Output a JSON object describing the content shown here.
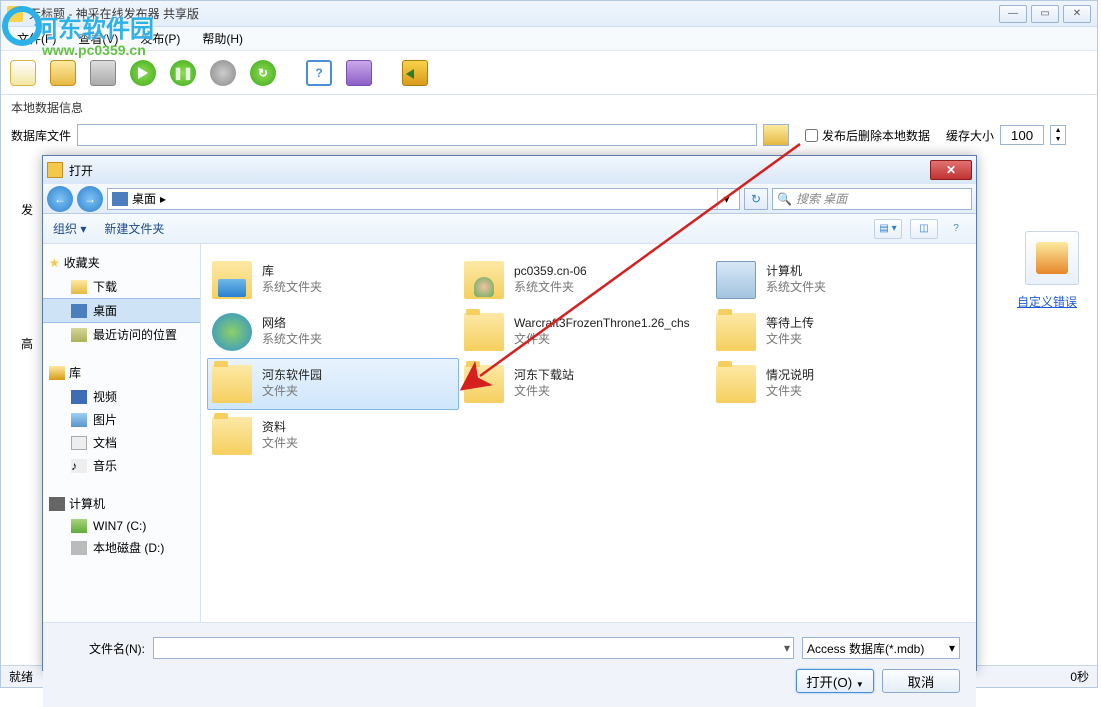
{
  "main": {
    "title": "无标题 - 神采在线发布器 共享版",
    "menu": {
      "file": "文件(F)",
      "view": "查看(V)",
      "publish": "发布(P)",
      "help": "帮助(H)"
    },
    "section_label": "本地数据信息",
    "db_label": "数据库文件",
    "chk_delete": "发布后删除本地数据",
    "cache_label": "缓存大小",
    "cache_value": "100",
    "col_tag": "发",
    "row_tag": "高",
    "custom_err": "自定义错误",
    "status_left": "就绪",
    "status_right": "0秒"
  },
  "watermark": {
    "text": "河东软件园",
    "url": "www.pc0359.cn"
  },
  "dialog": {
    "title": "打开",
    "location": "桌面",
    "search_placeholder": "搜索 桌面",
    "organize": "组织",
    "newfolder": "新建文件夹",
    "sidebar": {
      "fav": "收藏夹",
      "downloads": "下载",
      "desktop": "桌面",
      "recent": "最近访问的位置",
      "lib": "库",
      "video": "视频",
      "pic": "图片",
      "doc": "文档",
      "music": "音乐",
      "computer": "计算机",
      "drive1": "WIN7 (C:)",
      "drive2": "本地磁盘 (D:)"
    },
    "items": [
      {
        "name": "库",
        "type": "系统文件夹",
        "kind": "lib"
      },
      {
        "name": "pc0359.cn-06",
        "type": "系统文件夹",
        "kind": "user"
      },
      {
        "name": "计算机",
        "type": "系统文件夹",
        "kind": "comp"
      },
      {
        "name": "网络",
        "type": "系统文件夹",
        "kind": "net"
      },
      {
        "name": "Warcraft3FrozenThrone1.26_chs",
        "type": "文件夹",
        "kind": "folder"
      },
      {
        "name": "等待上传",
        "type": "文件夹",
        "kind": "folder"
      },
      {
        "name": "河东软件园",
        "type": "文件夹",
        "kind": "folder",
        "selected": true
      },
      {
        "name": "河东下载站",
        "type": "文件夹",
        "kind": "folder"
      },
      {
        "name": "情况说明",
        "type": "文件夹",
        "kind": "folder"
      },
      {
        "name": "资料",
        "type": "文件夹",
        "kind": "folder"
      }
    ],
    "filename_label": "文件名(N):",
    "filter": "Access 数据库(*.mdb)",
    "open_btn": "打开(O)",
    "cancel_btn": "取消"
  }
}
